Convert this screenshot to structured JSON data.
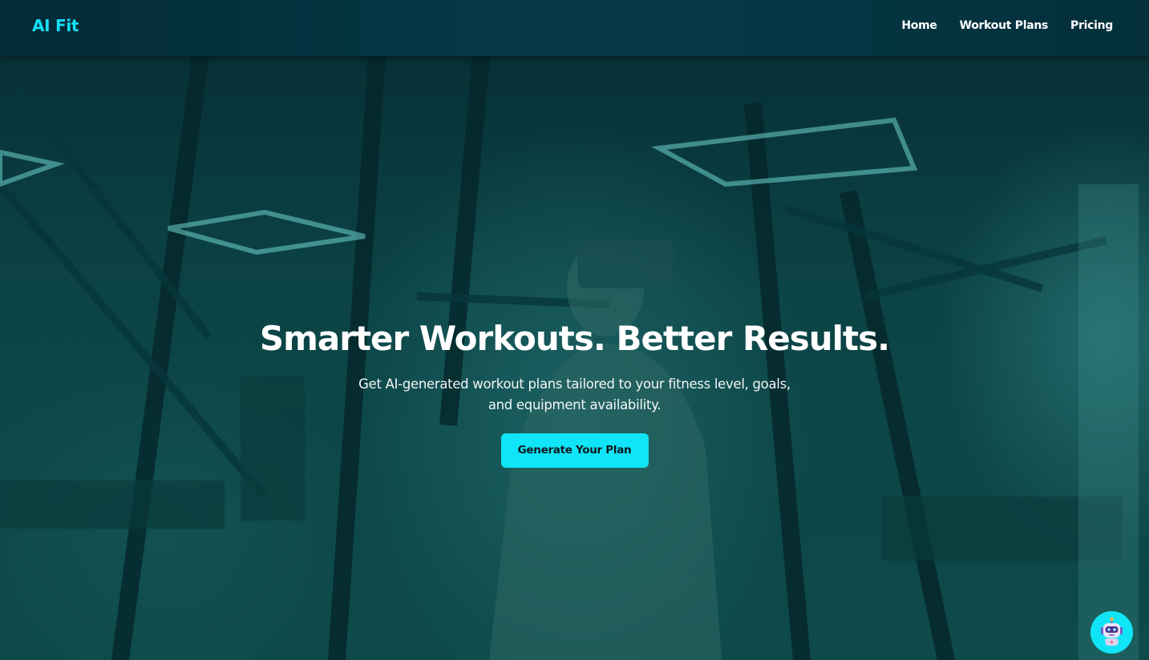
{
  "app": {
    "logo_text": "AI Fit"
  },
  "nav": {
    "items": [
      {
        "label": "Home"
      },
      {
        "label": "Workout Plans"
      },
      {
        "label": "Pricing"
      }
    ]
  },
  "hero": {
    "title": "Smarter Workouts. Better Results.",
    "subtitle": "Get AI-generated workout plans tailored to your fitness level, goals, and equipment availability.",
    "cta_label": "Generate Your Plan",
    "background_icon": "gym-photo"
  },
  "chatbot": {
    "icon": "robot-icon"
  },
  "colors": {
    "accent": "#10e4f7",
    "nav_bg": "#04303c",
    "hero_tint": "#0c4446"
  }
}
